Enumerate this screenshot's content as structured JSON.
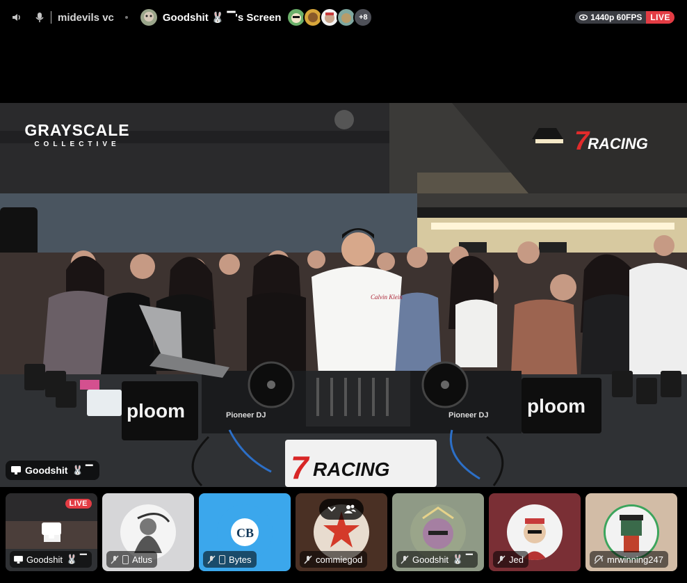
{
  "topbar": {
    "channel_name": "midevils vc",
    "stream_title": "Goodshit 🐰 ▔'s Screen",
    "extra_viewers": "+8",
    "quality": "1440p 60FPS",
    "live_label": "LIVE"
  },
  "stream": {
    "brand_left_main": "GRAYSCALE",
    "brand_left_sub": "COLLECTIVE",
    "brand_right_main": "RACING",
    "brand_right_num": "7",
    "sign_ploom": "ploom",
    "sign_pioneer": "Pioneer DJ",
    "streamer_label": "Goodshit",
    "streamer_emoji": "🐰 ▔"
  },
  "participants": [
    {
      "name": "Goodshit",
      "emoji": "🐰 ▔",
      "live": "LIVE"
    },
    {
      "name": "Atlus"
    },
    {
      "name": "Bytes"
    },
    {
      "name": "commiegod"
    },
    {
      "name": "Goodshit",
      "emoji": "🐰 ▔"
    },
    {
      "name": "Jed"
    },
    {
      "name": "mrwinning247"
    }
  ],
  "colors": {
    "live_red": "#e33c44",
    "accent_racing_red": "#e12b2b",
    "bytes_tile": "#3ba7ec",
    "jed_tile": "#7a2f35",
    "mrwinning_tile": "#d2bca6"
  }
}
